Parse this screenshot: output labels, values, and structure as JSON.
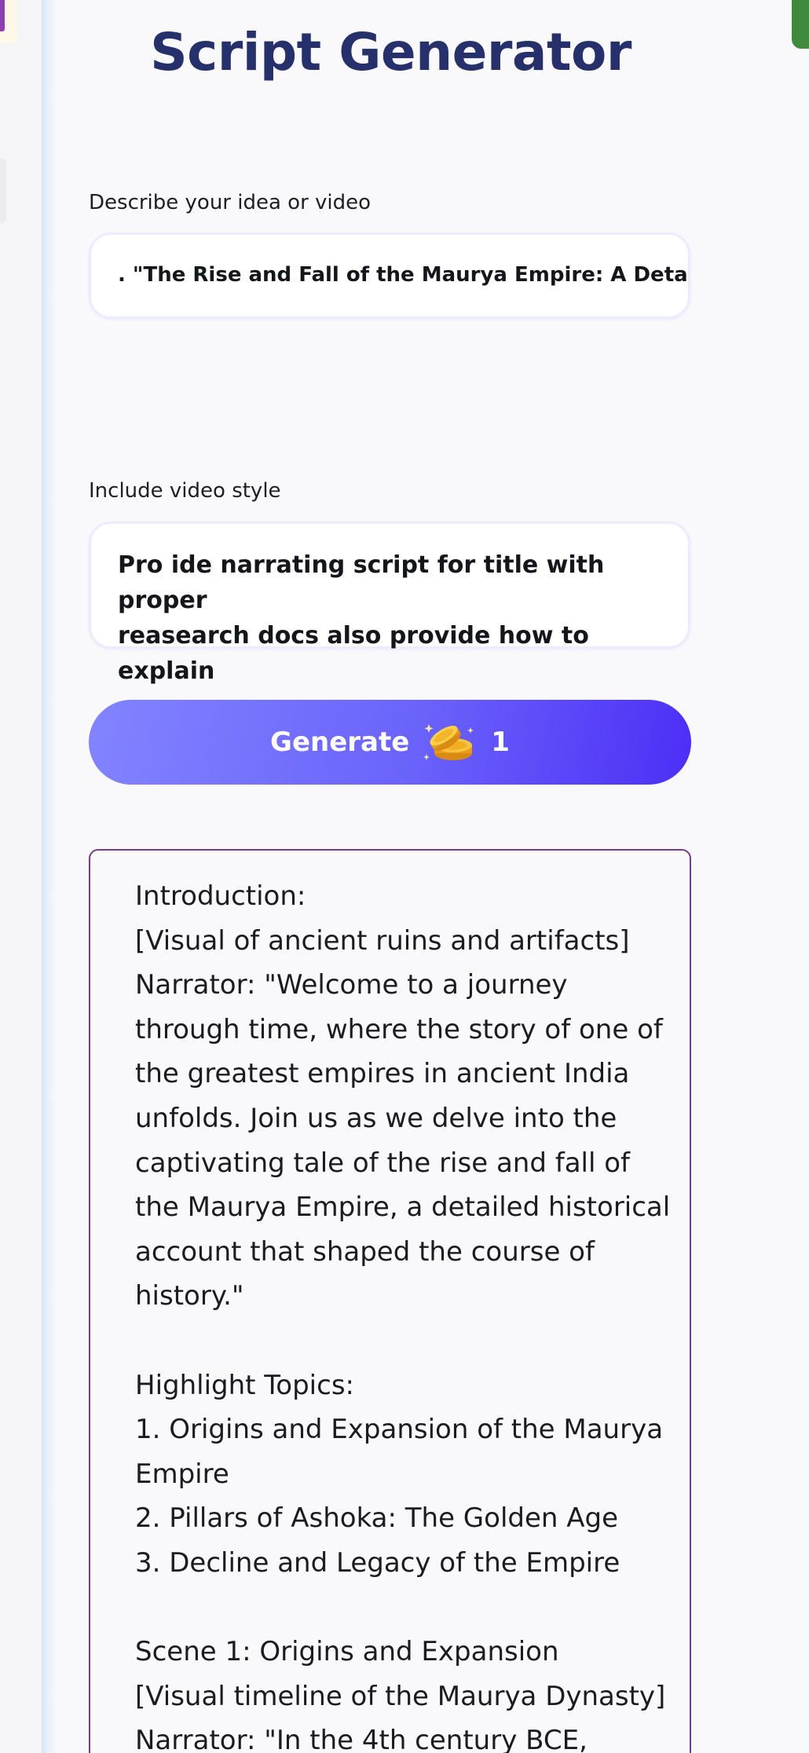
{
  "page": {
    "title": "Script Generator"
  },
  "idea_field": {
    "label": "Describe your idea or video",
    "value": ". \"The Rise and Fall of the Maurya Empire: A Detailed"
  },
  "style_field": {
    "label": "Include video style",
    "value_lines": [
      "Pro ide narrating script for title with proper",
      "reasearch docs also provide how to explain"
    ]
  },
  "generate_button": {
    "label": "Generate",
    "icon": "coins-icon",
    "cost": "1"
  },
  "output": {
    "lines": [
      "Introduction:",
      "[Visual of ancient ruins and artifacts]",
      "Narrator: \"Welcome to a journey",
      "through time, where the story of one of",
      "the greatest empires in ancient India",
      "unfolds. Join us as we delve into the",
      "captivating tale of the rise and fall of",
      "the Maurya Empire, a detailed historical",
      "account that shaped the course of",
      "history.\"",
      "",
      "Highlight Topics:",
      "1. Origins and Expansion of the Maurya",
      "Empire",
      "2. Pillars of Ashoka: The Golden Age",
      "3. Decline and Legacy of the Empire",
      "",
      "Scene 1: Origins and Expansion",
      "[Visual timeline of the Maurya Dynasty]",
      "Narrator: \"In the 4th century BCE,"
    ]
  },
  "colors": {
    "title": "#26306a",
    "button_start": "#8284ff",
    "button_end": "#4c2ef6",
    "output_border": "#7a3a8a",
    "left_accent": "#8e3fb0",
    "right_accent": "#3f8a3c"
  }
}
